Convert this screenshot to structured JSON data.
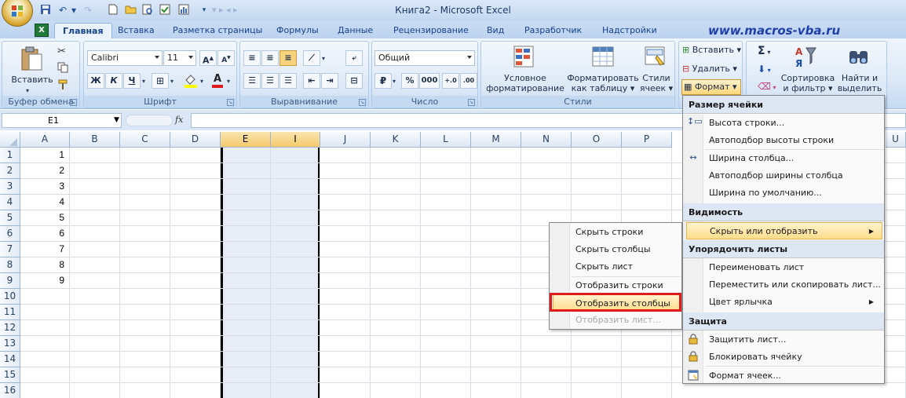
{
  "window": {
    "title": "Книга2 - Microsoft Excel",
    "qat_dim_text": "▾ ▸ ◂ ▸"
  },
  "tabs": [
    "Главная",
    "Вставка",
    "Разметка страницы",
    "Формулы",
    "Данные",
    "Рецензирование",
    "Вид",
    "Разработчик",
    "Надстройки"
  ],
  "watermark": "www.macros-vba.ru",
  "ribbon": {
    "clipboard": {
      "label": "Буфер обмена",
      "paste": "Вставить"
    },
    "font": {
      "label": "Шрифт",
      "font_name": "Calibri",
      "font_size": "11",
      "bold": "Ж",
      "italic": "К",
      "underline": "Ч",
      "grow": "A",
      "shrink": "A",
      "color_letter": "A"
    },
    "alignment": {
      "label": "Выравнивание"
    },
    "number": {
      "label": "Число",
      "format": "Общий",
      "percent": "%",
      "thousands": "000"
    },
    "styles": {
      "label": "Стили",
      "conditional": [
        "Условное",
        "форматирование"
      ],
      "table": [
        "Форматировать",
        "как таблицу"
      ],
      "cell_styles": [
        "Стили",
        "ячеек"
      ]
    },
    "cells": {
      "insert": "Вставить",
      "delete": "Удалить",
      "format": "Формат"
    },
    "editing": {
      "sort": [
        "Сортировка",
        "и фильтр"
      ],
      "find": [
        "Найти и",
        "выделить"
      ],
      "sigma": "Σ"
    }
  },
  "formula_bar": {
    "name_box": "E1",
    "fx": "fx",
    "value": ""
  },
  "grid": {
    "columns": [
      "A",
      "B",
      "C",
      "D",
      "E",
      "I",
      "J",
      "K",
      "L",
      "M",
      "N",
      "O",
      "P",
      "U"
    ],
    "selected_columns": [
      "E",
      "I"
    ],
    "rows": [
      "1",
      "2",
      "3",
      "4",
      "5",
      "6",
      "7",
      "8",
      "9",
      "10",
      "11",
      "12",
      "13",
      "14",
      "15",
      "16"
    ],
    "column_a_values": [
      "1",
      "2",
      "3",
      "4",
      "5",
      "6",
      "7",
      "8",
      "9"
    ]
  },
  "format_menu": {
    "sections": [
      {
        "title": "Размер ячейки",
        "items": [
          {
            "label": "Высота строки...",
            "icon": "row-height-icon"
          },
          {
            "label": "Автоподбор высоты строки"
          },
          {
            "label": "Ширина столбца...",
            "icon": "column-width-icon"
          },
          {
            "label": "Автоподбор ширины столбца"
          },
          {
            "label": "Ширина по умолчанию..."
          }
        ]
      },
      {
        "title": "Видимость",
        "items": [
          {
            "label": "Скрыть или отобразить",
            "highlighted": true,
            "submenu": true
          }
        ]
      },
      {
        "title": "Упорядочить листы",
        "items": [
          {
            "label": "Переименовать лист"
          },
          {
            "label": "Переместить или скопировать лист..."
          },
          {
            "label": "Цвет ярлычка",
            "submenu": true
          }
        ]
      },
      {
        "title": "Защита",
        "items": [
          {
            "label": "Защитить лист...",
            "icon": "protect-sheet-icon"
          },
          {
            "label": "Блокировать ячейку",
            "icon": "lock-cell-icon"
          },
          {
            "label": "Формат ячеек...",
            "icon": "format-cells-icon"
          }
        ]
      }
    ]
  },
  "hide_menu": {
    "items": [
      {
        "label": "Скрыть строки"
      },
      {
        "label": "Скрыть столбцы"
      },
      {
        "label": "Скрыть лист"
      },
      {
        "label": "Отобразить строки"
      },
      {
        "label": "Отобразить столбцы",
        "highlighted": true
      },
      {
        "label": "Отобразить лист...",
        "disabled": true
      }
    ]
  },
  "colors": {
    "accent": "#1f3fa8",
    "highlight_box": "#e01b1b",
    "ribbon": "#dce8f7"
  }
}
